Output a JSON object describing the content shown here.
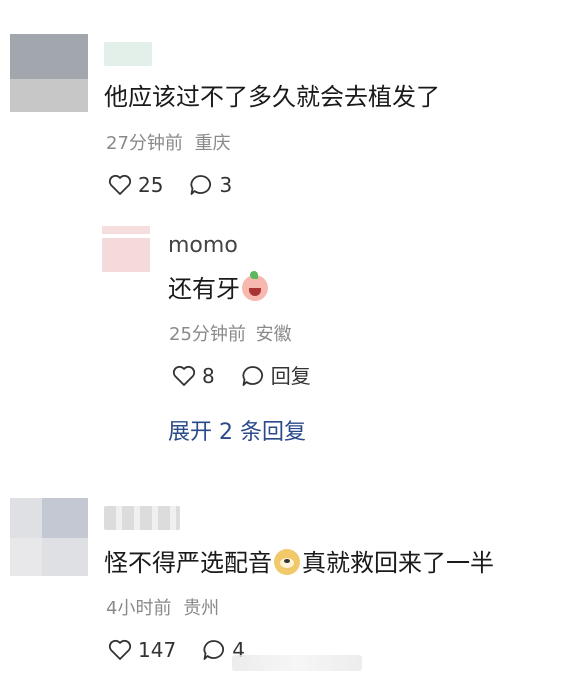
{
  "comments": [
    {
      "text": "他应该过不了多久就会去植发了",
      "time": "27分钟前",
      "location": "重庆",
      "likes": "25",
      "replies": "3"
    },
    {
      "text_before": "怪不得严选配音",
      "emoji_icon": "dog-face-emoji",
      "text_after": "真就救回来了一半",
      "time": "4小时前",
      "location": "贵州",
      "likes": "147",
      "replies": "4"
    }
  ],
  "reply": {
    "username": "momo",
    "text": "还有牙",
    "emoji_icon": "crying-laughing-emoji",
    "time": "25分钟前",
    "location": "安徽",
    "likes": "8",
    "reply_label": "回复"
  },
  "expand": {
    "label": "展开 2 条回复"
  },
  "icons": {
    "like": "heart-outline-icon",
    "comment": "speech-bubble-icon"
  },
  "colors": {
    "text": "#1a1a1a",
    "meta": "#8a8a8a",
    "expand_link": "#2a4a8a"
  }
}
